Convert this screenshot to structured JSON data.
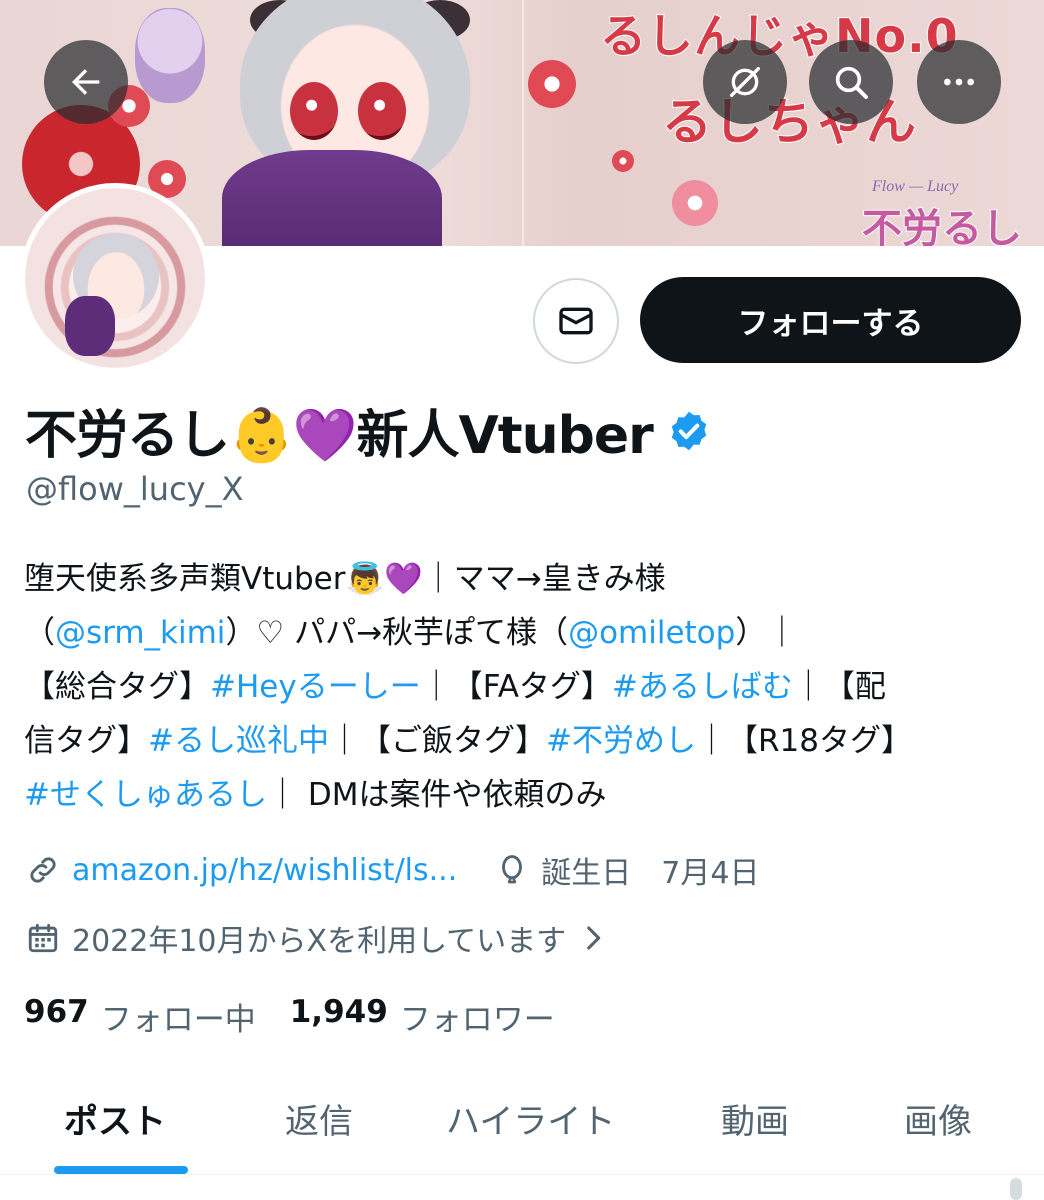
{
  "banner": {
    "title_line1": "るしんじゃNo.0",
    "title_line2": "るしちゃん",
    "logo_sub": "Flow — Lucy",
    "logo_main": "不労るし"
  },
  "header_buttons": {
    "back": "arrow-left-icon",
    "hide": "eye-slash-icon",
    "search": "search-icon",
    "more": "more-icon"
  },
  "actions": {
    "message_icon": "mail-icon",
    "follow_label": "フォローする"
  },
  "profile": {
    "display_name": "不労るし👶💜新人Vtuber",
    "verified": true,
    "handle": "@flow_lucy_X"
  },
  "bio": {
    "line1": {
      "text": "堕天使系多声類Vtuber👼💜｜ママ→皇きみ様"
    },
    "line2": {
      "a": "（",
      "b": "@srm_kimi",
      "c": "）♡ パパ→秋芋ぽて様（",
      "d": "@omiletop",
      "e": "）｜"
    },
    "line3": {
      "a": "【総合タグ】",
      "b": "#Heyるーしー",
      "c": "｜【FAタグ】",
      "d": "#あるしばむ",
      "e": "｜【配"
    },
    "line4": {
      "a": "信タグ】",
      "b": "#るし巡礼中",
      "c": "｜【ご飯タグ】",
      "d": "#不労めし",
      "e": "｜【R18タグ】"
    },
    "line5": {
      "a": "#せくしゅあるし",
      "b": "｜ DMは案件や依頼のみ"
    }
  },
  "meta": {
    "link_icon": "link-icon",
    "link_text": "amazon.jp/hz/wishlist/ls...",
    "birthday_icon": "balloon-icon",
    "birthday_text": "誕生日　7月4日",
    "joined_icon": "calendar-icon",
    "joined_text": "2022年10月からXを利用しています",
    "chevron": "chevron-right-icon"
  },
  "counts": {
    "following_num": "967",
    "following_label": "フォロー中",
    "followers_num": "1,949",
    "followers_label": "フォロワー"
  },
  "tabs": [
    {
      "label": "ポスト",
      "active": true
    },
    {
      "label": "返信",
      "active": false
    },
    {
      "label": "ハイライト",
      "active": false
    },
    {
      "label": "動画",
      "active": false
    },
    {
      "label": "画像",
      "active": false
    }
  ],
  "colors": {
    "accent": "#1d9bf0",
    "text": "#0f1419",
    "secondary": "#536471",
    "follow_bg": "#0f1419"
  }
}
